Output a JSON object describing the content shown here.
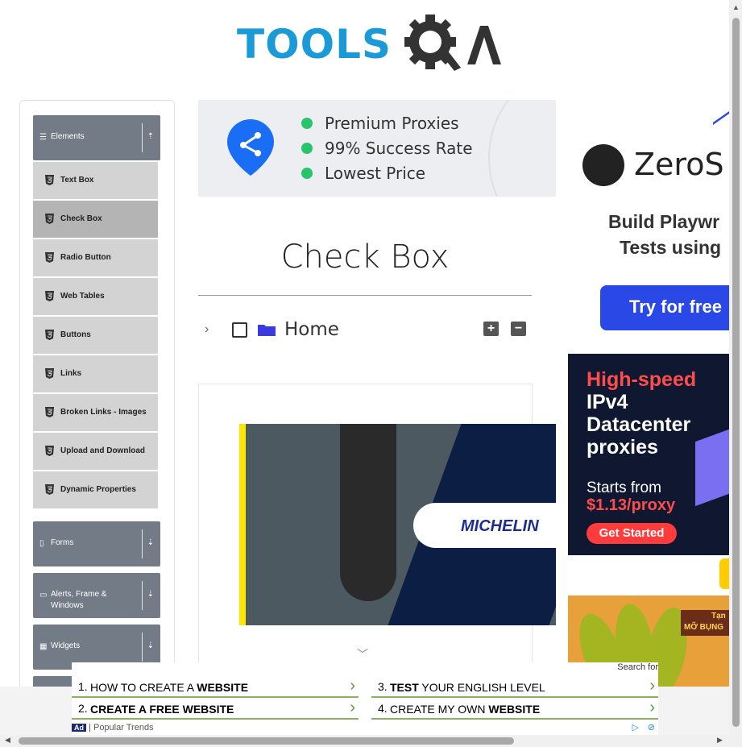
{
  "header": {
    "logo_text": "TOOLS",
    "logo_suffix": "QA"
  },
  "sidebar": {
    "groups": [
      {
        "label": "Elements",
        "expanded": true
      },
      {
        "label": "Forms",
        "expanded": false
      },
      {
        "label": "Alerts, Frame &",
        "label2": "Windows",
        "expanded": false
      },
      {
        "label": "Widgets",
        "expanded": false
      }
    ],
    "items": [
      {
        "label": "Text Box"
      },
      {
        "label": "Check Box",
        "active": true
      },
      {
        "label": "Radio Button"
      },
      {
        "label": "Web Tables"
      },
      {
        "label": "Buttons"
      },
      {
        "label": "Links"
      },
      {
        "label": "Broken Links - Images"
      },
      {
        "label": "Upload and Download"
      },
      {
        "label": "Dynamic Properties"
      }
    ]
  },
  "banner_ad": {
    "lines": [
      "Premium Proxies",
      "99% Success Rate",
      "Lowest Price"
    ],
    "check_color": "#27c46b",
    "pin_color": "#1a6ef5"
  },
  "main": {
    "title": "Check Box",
    "tree": {
      "node_label": "Home",
      "expand_all_label": "+",
      "collapse_all_label": "−"
    }
  },
  "video_ad": {
    "brand": "MICHELIN"
  },
  "right_ads": {
    "zerostep": {
      "brand": "ZeroS",
      "line1": "Build Playwr",
      "line2": "Tests using",
      "button": "Try for free"
    },
    "proxy": {
      "headline_red": "High-speed",
      "headline_white": "IPv4 Datacenter proxies",
      "starts": "Starts from",
      "price": "$1.13/proxy",
      "button": "Get Started"
    },
    "banana": {
      "tag1": "Tạn",
      "tag2": "MỠ BỤNG"
    }
  },
  "bottom_ad": {
    "search_for": "Search for",
    "rows": [
      {
        "num": "1.",
        "pre": "How to create a ",
        "bold": "website"
      },
      {
        "num": "2.",
        "pre": "",
        "bold": "Create",
        "post": " a free website"
      },
      {
        "num": "3.",
        "pre": "",
        "bold": "Test",
        "post": " your English level"
      },
      {
        "num": "4.",
        "pre": "Create my own ",
        "bold": "website"
      }
    ],
    "ad_badge": "Ad",
    "ad_caption": "| Popular Trends"
  },
  "colors": {
    "brand_blue": "#1a9bd7",
    "menu_header": "#737b86",
    "menu_item": "#d3d3d3",
    "active_item": "#b4b4b4",
    "folder": "#3a3ae0",
    "ad_green": "#8ab35f"
  }
}
